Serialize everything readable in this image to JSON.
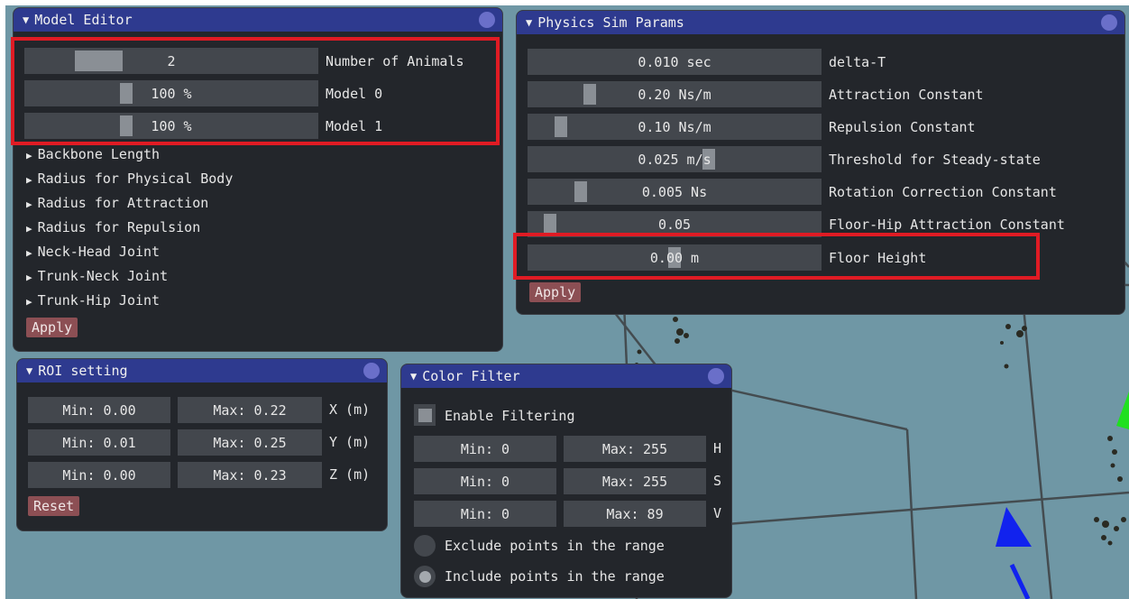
{
  "model_editor": {
    "title": "Model Editor",
    "sliders": [
      {
        "value": "2",
        "label": "Number of Animals"
      },
      {
        "value": "100 %",
        "label": "Model 0"
      },
      {
        "value": "100 %",
        "label": "Model 1"
      }
    ],
    "tree_items": [
      "Backbone Length",
      "Radius for Physical Body",
      "Radius for Attraction",
      "Radius for Repulsion",
      "Neck-Head Joint",
      "Trunk-Neck Joint",
      "Trunk-Hip Joint"
    ],
    "apply_label": "Apply"
  },
  "physics": {
    "title": "Physics Sim Params",
    "params": [
      {
        "value": "0.010 sec",
        "label": "delta-T"
      },
      {
        "value": "0.20 Ns/m",
        "label": "Attraction Constant"
      },
      {
        "value": "0.10 Ns/m",
        "label": "Repulsion Constant"
      },
      {
        "value": "0.025 m/s",
        "label": "Threshold for Steady-state"
      },
      {
        "value": "0.005 Ns",
        "label": "Rotation Correction Constant"
      },
      {
        "value": "0.05",
        "label": "Floor-Hip Attraction Constant"
      },
      {
        "value": "0.00 m",
        "label": "Floor Height"
      }
    ],
    "apply_label": "Apply"
  },
  "roi": {
    "title": "ROI setting",
    "rows": [
      {
        "min": "Min: 0.00",
        "max": "Max: 0.22",
        "axis": "X (m)"
      },
      {
        "min": "Min: 0.01",
        "max": "Max: 0.25",
        "axis": "Y (m)"
      },
      {
        "min": "Min: 0.00",
        "max": "Max: 0.23",
        "axis": "Z (m)"
      }
    ],
    "reset_label": "Reset"
  },
  "color_filter": {
    "title": "Color Filter",
    "enable_label": "Enable Filtering",
    "rows": [
      {
        "min": "Min: 0",
        "max": "Max: 255",
        "channel": "H"
      },
      {
        "min": "Min: 0",
        "max": "Max: 255",
        "channel": "S"
      },
      {
        "min": "Min: 0",
        "max": "Max: 89",
        "channel": "V"
      }
    ],
    "exclude_label": "Exclude points in the range",
    "include_label": "Include points in the range"
  },
  "colors": {
    "scene_bg": "#6f97a5",
    "title_bar": "#2e3a8f",
    "window_bg": "#23262b",
    "button": "#8c4f54",
    "highlight": "#e01b24"
  }
}
